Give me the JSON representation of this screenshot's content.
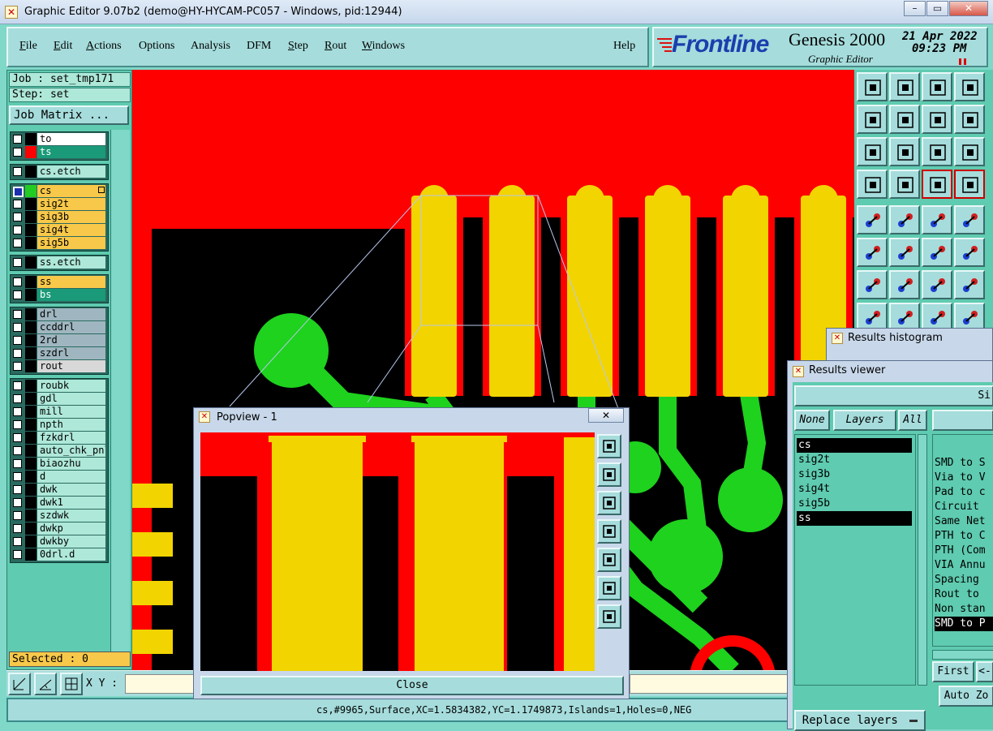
{
  "window": {
    "title": "Graphic Editor 9.07b2 (demo@HY-HYCAM-PC057 - Windows, pid:12944)",
    "min": "–",
    "max": "▭",
    "close": "✕"
  },
  "menu": [
    {
      "pre": "",
      "u": "F",
      "post": "ile"
    },
    {
      "pre": "",
      "u": "E",
      "post": "dit"
    },
    {
      "pre": "",
      "u": "A",
      "post": "ctions"
    },
    {
      "pre": "Options",
      "u": "",
      "post": ""
    },
    {
      "pre": "Analysis",
      "u": "",
      "post": ""
    },
    {
      "pre": "DFM",
      "u": "",
      "post": ""
    },
    {
      "pre": "",
      "u": "S",
      "post": "tep"
    },
    {
      "pre": "",
      "u": "R",
      "post": "out"
    },
    {
      "pre": "",
      "u": "W",
      "post": "indows"
    }
  ],
  "help": "Help",
  "brand": {
    "logo": "Frontline",
    "product": "Genesis 2000",
    "subtitle": "Graphic Editor",
    "date": "21 Apr 2022",
    "time": "09:23 PM"
  },
  "job": {
    "job_line": "Job : set_tmp171",
    "step_line": "Step: set",
    "matrix_button": "Job Matrix ..."
  },
  "layers": [
    {
      "name": "to",
      "bg": "#ffffff",
      "sw": "#000000",
      "box": "#ffffff"
    },
    {
      "name": "ts",
      "bg": "#1a9a78",
      "sw": "#ff0000",
      "box": "#ffffff"
    },
    {
      "name": "cs.etch",
      "bg": "#aee8d8",
      "sw": "#000000",
      "box": "#ffffff"
    },
    {
      "name": "cs",
      "bg": "#f7c84a",
      "sw": "#22cc22",
      "box": "#1b2fb0",
      "selected": true
    },
    {
      "name": "sig2t",
      "bg": "#f7c84a",
      "sw": "#000000",
      "box": "#ffffff"
    },
    {
      "name": "sig3b",
      "bg": "#f7c84a",
      "sw": "#000000",
      "box": "#ffffff"
    },
    {
      "name": "sig4t",
      "bg": "#f7c84a",
      "sw": "#000000",
      "box": "#ffffff"
    },
    {
      "name": "sig5b",
      "bg": "#f7c84a",
      "sw": "#000000",
      "box": "#ffffff"
    },
    {
      "name": "ss.etch",
      "bg": "#aee8d8",
      "sw": "#000000",
      "box": "#ffffff"
    },
    {
      "name": "ss",
      "bg": "#f7c84a",
      "sw": "#000000",
      "box": "#ffffff"
    },
    {
      "name": "bs",
      "bg": "#1a9a78",
      "sw": "#000000",
      "box": "#ffffff"
    },
    {
      "name": "drl",
      "bg": "#9fb6c0",
      "sw": "#000000",
      "box": "#ffffff"
    },
    {
      "name": "ccddrl",
      "bg": "#9fb6c0",
      "sw": "#000000",
      "box": "#ffffff"
    },
    {
      "name": "2rd",
      "bg": "#9fb6c0",
      "sw": "#000000",
      "box": "#ffffff"
    },
    {
      "name": "szdrl",
      "bg": "#9fb6c0",
      "sw": "#000000",
      "box": "#ffffff"
    },
    {
      "name": "rout",
      "bg": "#d8d8d8",
      "sw": "#000000",
      "box": "#ffffff"
    },
    {
      "name": "roubk",
      "bg": "#aee8d8",
      "sw": "#000000",
      "box": "#ffffff"
    },
    {
      "name": "gdl",
      "bg": "#aee8d8",
      "sw": "#000000",
      "box": "#ffffff"
    },
    {
      "name": "mill",
      "bg": "#aee8d8",
      "sw": "#000000",
      "box": "#ffffff"
    },
    {
      "name": "npth",
      "bg": "#aee8d8",
      "sw": "#000000",
      "box": "#ffffff"
    },
    {
      "name": "fzkdrl",
      "bg": "#aee8d8",
      "sw": "#000000",
      "box": "#ffffff"
    },
    {
      "name": "auto_chk_pnl",
      "bg": "#aee8d8",
      "sw": "#000000",
      "box": "#ffffff"
    },
    {
      "name": "biaozhu",
      "bg": "#aee8d8",
      "sw": "#000000",
      "box": "#ffffff"
    },
    {
      "name": "d",
      "bg": "#aee8d8",
      "sw": "#000000",
      "box": "#ffffff"
    },
    {
      "name": "dwk",
      "bg": "#aee8d8",
      "sw": "#000000",
      "box": "#ffffff"
    },
    {
      "name": "dwk1",
      "bg": "#aee8d8",
      "sw": "#000000",
      "box": "#ffffff"
    },
    {
      "name": "szdwk",
      "bg": "#aee8d8",
      "sw": "#000000",
      "box": "#ffffff"
    },
    {
      "name": "dwkp",
      "bg": "#aee8d8",
      "sw": "#000000",
      "box": "#ffffff"
    },
    {
      "name": "dwkby",
      "bg": "#aee8d8",
      "sw": "#000000",
      "box": "#ffffff"
    },
    {
      "name": "0drl.d",
      "bg": "#aee8d8",
      "sw": "#000000",
      "box": "#ffffff"
    }
  ],
  "selected": "Selected : 0",
  "xy_label": "X Y :",
  "status": "cs,#9965,Surface,XC=1.5834382,YC=1.1749873,Islands=1,Holes=0,NEG",
  "popview": {
    "title": "Popview - 1",
    "close_x": "✕",
    "close_button": "Close"
  },
  "histogram": {
    "title": "Results histogram"
  },
  "viewer": {
    "title": "Results viewer",
    "header_partial": "Si",
    "none_btn": "None",
    "layers_btn": "Layers",
    "all_btn": "All",
    "layer_list": [
      "cs",
      "sig2t",
      "sig3b",
      "sig4t",
      "sig5b",
      "ss"
    ],
    "checks": [
      "SMD to S",
      "Via to V",
      "Pad to c",
      "Circuit",
      "Same Net",
      "PTH to C",
      "PTH (Com",
      "VIA Annu",
      "Spacing",
      "Rout to",
      "Non stan",
      "SMD to P"
    ],
    "first_btn": "First",
    "prev_btn": "<-",
    "auto_zoom": "Auto Zo",
    "replace": "Replace layers"
  }
}
